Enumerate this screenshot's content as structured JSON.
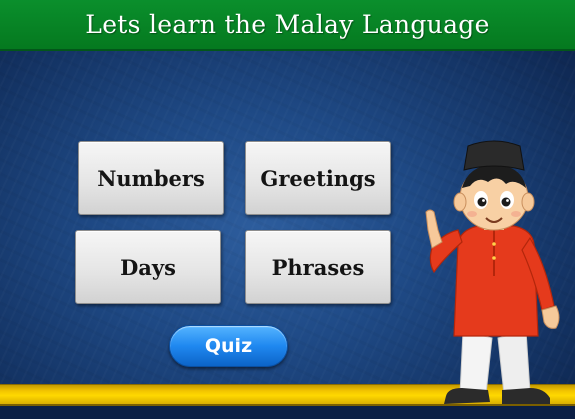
{
  "header": {
    "title": "Lets learn the Malay Language"
  },
  "menu": {
    "numbers_label": "Numbers",
    "greetings_label": "Greetings",
    "days_label": "Days",
    "phrases_label": "Phrases"
  },
  "quiz": {
    "label": "Quiz"
  },
  "colors": {
    "title_bar": "#0a8f2c",
    "board": "#1f4a86",
    "quiz_button": "#1f88f0",
    "rail": "#ffd800",
    "shirt": "#e53a1c",
    "cap": "#2a2a2a"
  },
  "illustration": {
    "character": "boy-character"
  }
}
